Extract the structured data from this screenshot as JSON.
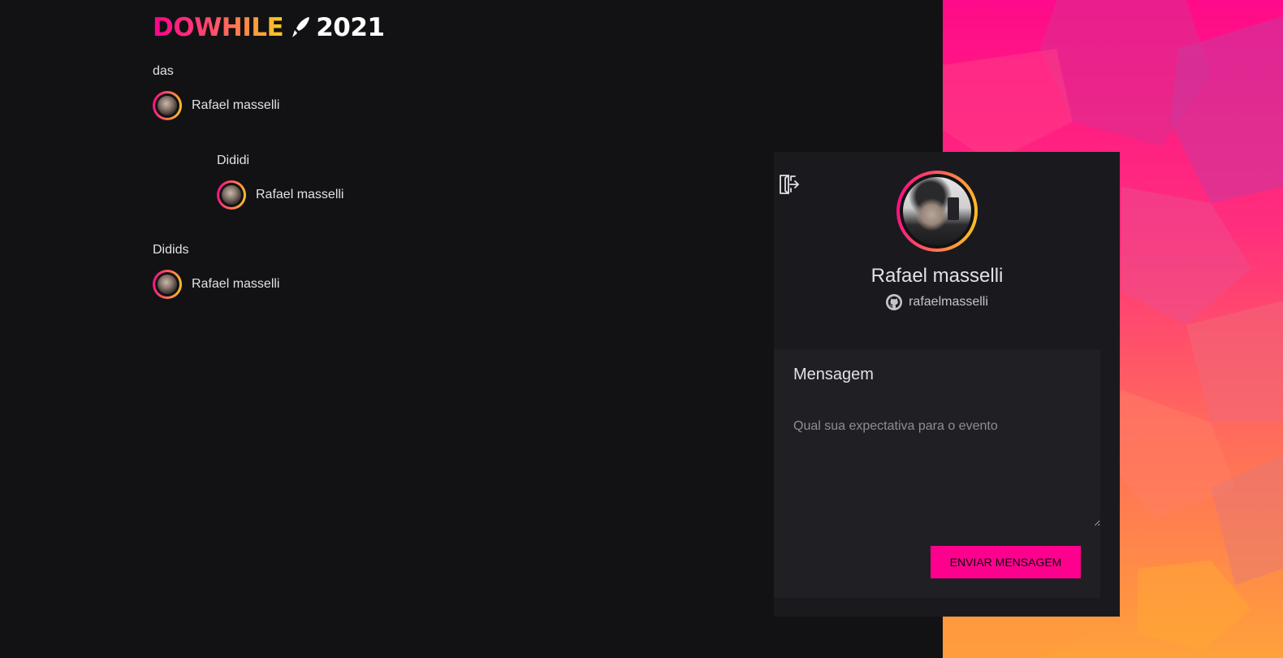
{
  "logo": {
    "brand": "DOWHILE",
    "year": "2021"
  },
  "messages": [
    {
      "text": "das",
      "user": "Rafael masselli"
    },
    {
      "text": "Dididi",
      "user": "Rafael masselli"
    },
    {
      "text": "Didids",
      "user": "Rafael masselli"
    }
  ],
  "profile": {
    "name": "Rafael masselli",
    "github": "rafaelmasselli",
    "github_icon": "github-icon",
    "signout_icon": "sign-out-icon"
  },
  "form": {
    "label": "Mensagem",
    "placeholder": "Qual sua expectativa para o evento",
    "value": "",
    "button_label": "ENVIAR MENSAGEM"
  },
  "colors": {
    "background": "#121214",
    "card": "#1a1a1e",
    "form": "#202024",
    "accent": "#ff008e",
    "accent_end": "#ffcd1e",
    "text": "#e1e1e6"
  }
}
